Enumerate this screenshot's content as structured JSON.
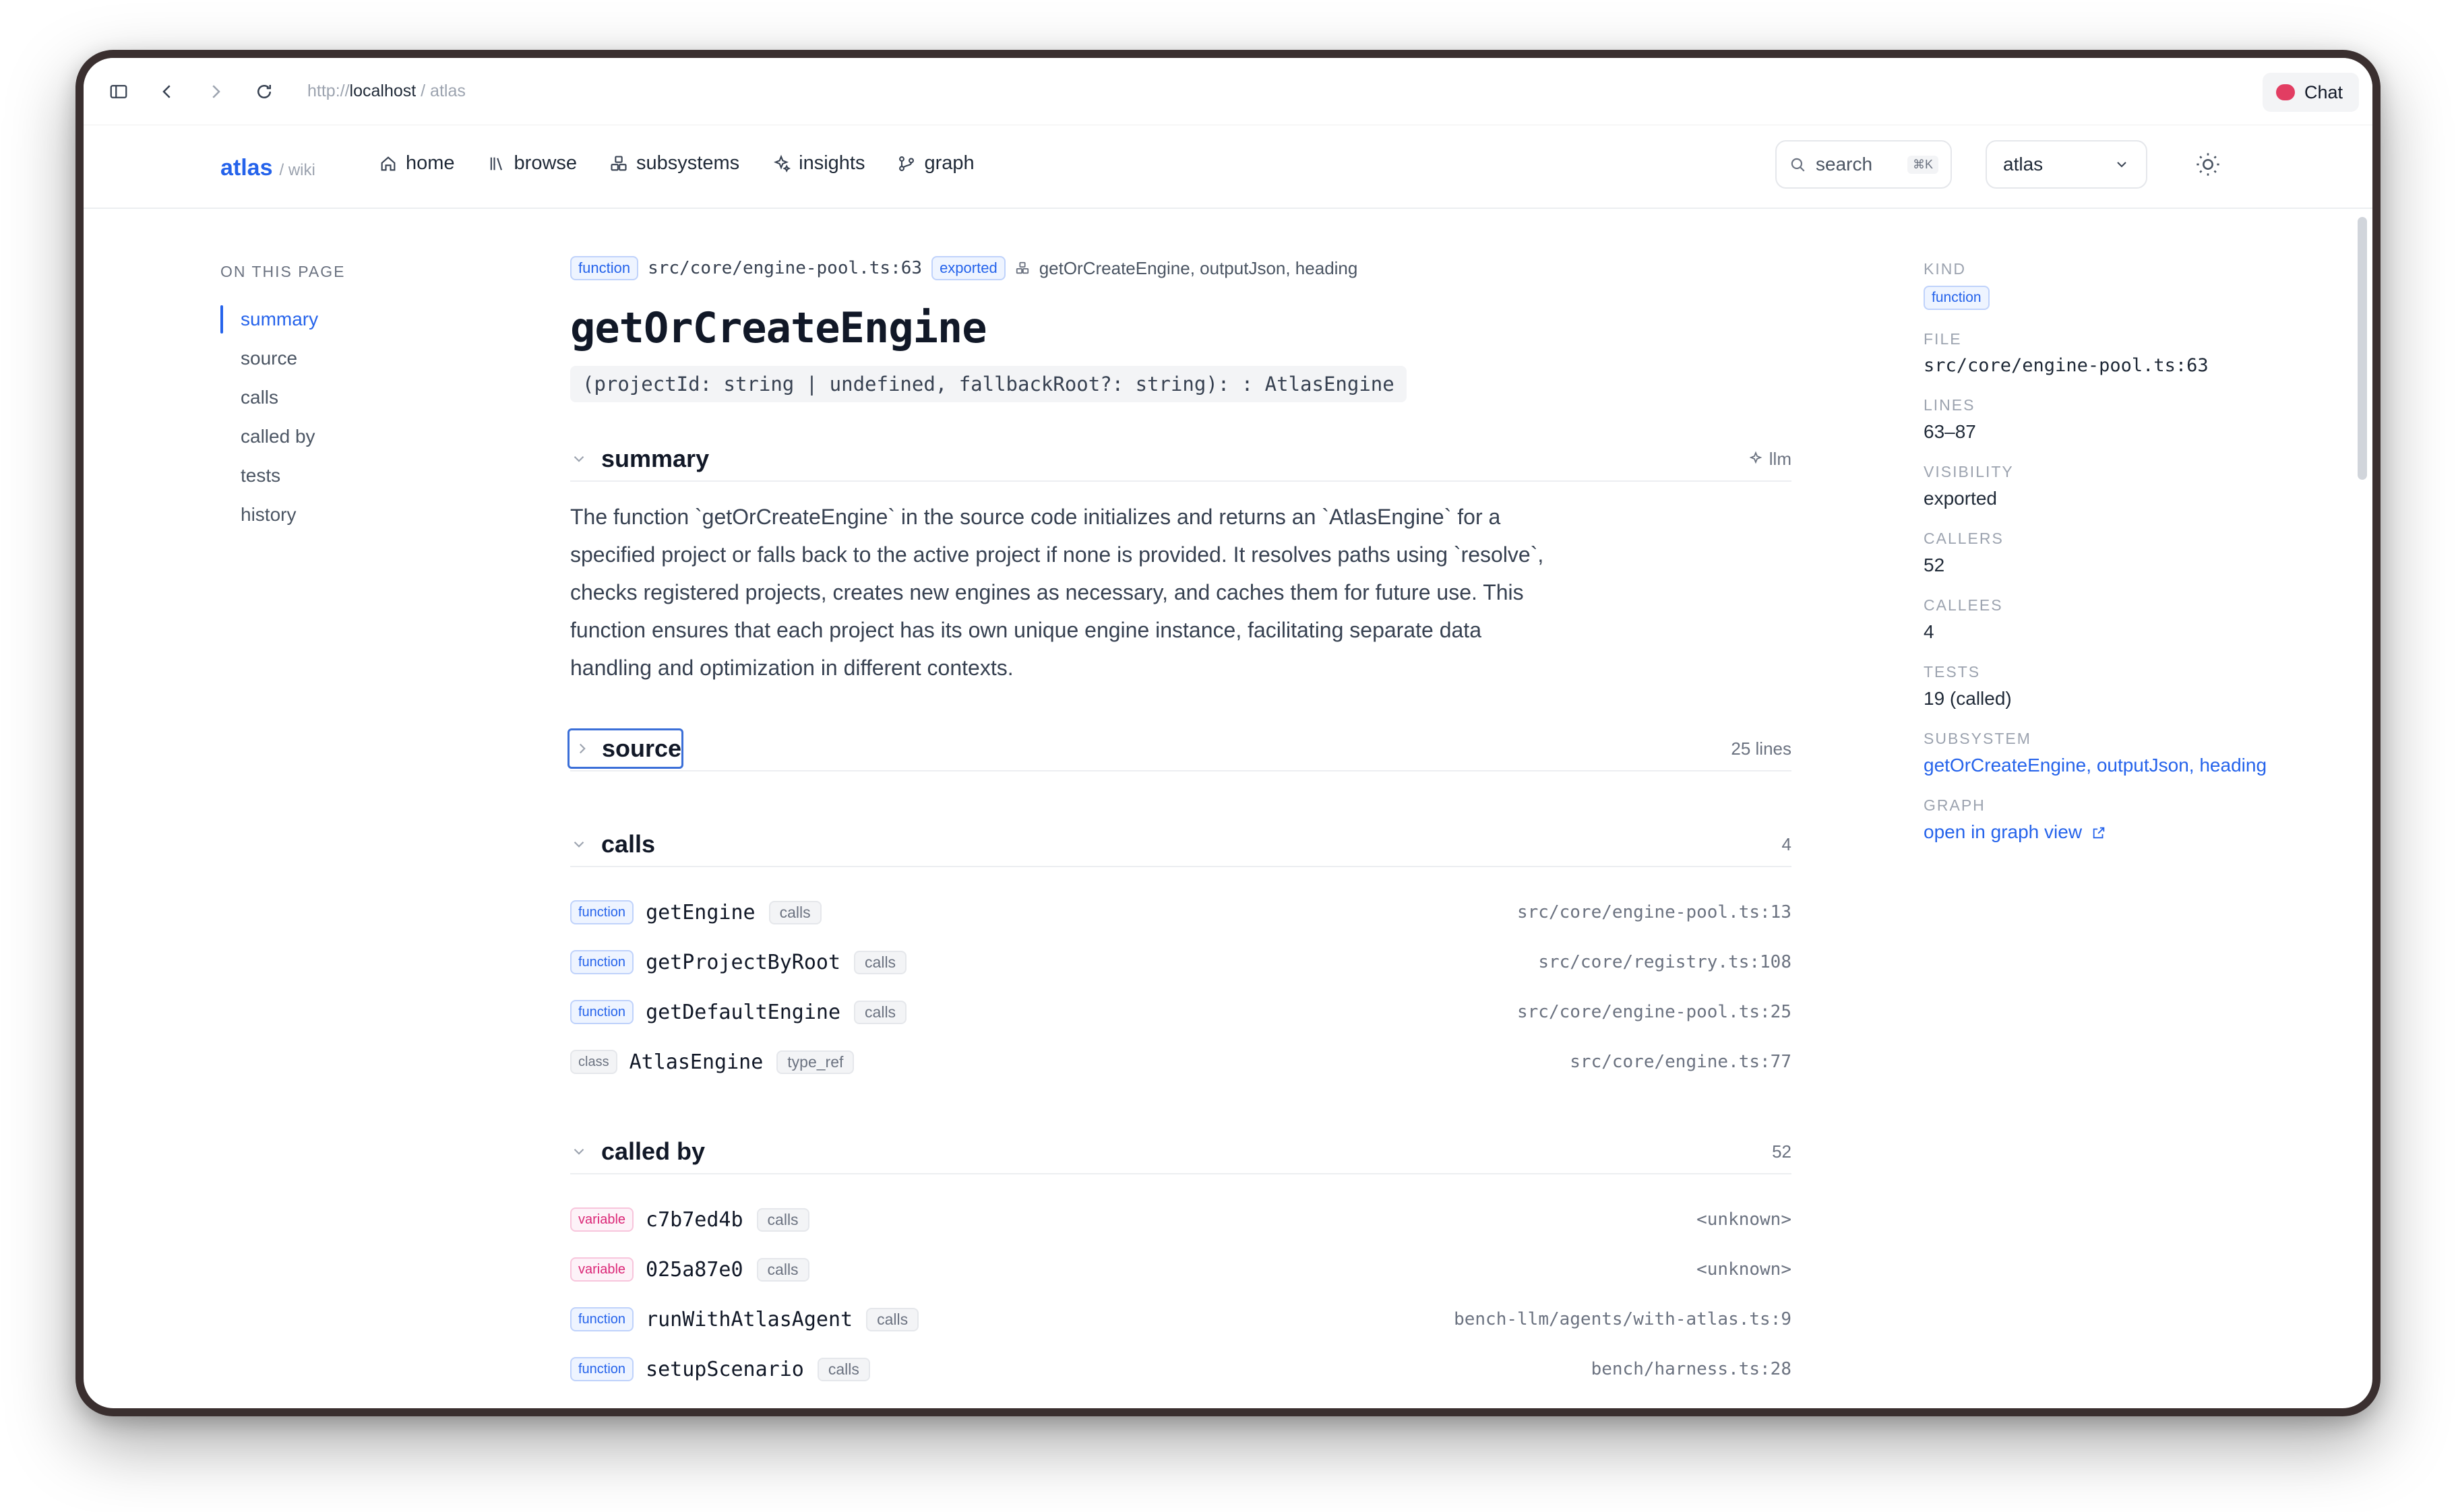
{
  "browser": {
    "url_prefix": "http://",
    "url_host": "localhost",
    "url_path": " / atlas",
    "chat_label": "Chat"
  },
  "header": {
    "brand": "atlas",
    "brand_sub": "/ wiki",
    "nav": [
      "home",
      "browse",
      "subsystems",
      "insights",
      "graph"
    ],
    "search_placeholder": "search",
    "search_shortcut": "⌘K",
    "project_select": "atlas"
  },
  "toc": {
    "heading": "ON THIS PAGE",
    "items": [
      "summary",
      "source",
      "calls",
      "called by",
      "tests",
      "history"
    ]
  },
  "symbol": {
    "kind_badge": "function",
    "file": "src/core/engine-pool.ts:63",
    "visibility_badge": "exported",
    "subsystems": "getOrCreateEngine, outputJson, heading",
    "name": "getOrCreateEngine",
    "signature": "(projectId: string | undefined, fallbackRoot?: string): : AtlasEngine"
  },
  "summary": {
    "title": "summary",
    "source_tag": "llm",
    "text": "The function `getOrCreateEngine` in the source code initializes and returns an `AtlasEngine` for a specified project or falls back to the active project if none is provided. It resolves paths using `resolve`, checks registered projects, creates new engines as necessary, and caches them for future use. This function ensures that each project has its own unique engine instance, facilitating separate data handling and optimization in different contexts."
  },
  "source": {
    "title": "source",
    "count": "25 lines"
  },
  "calls": {
    "title": "calls",
    "count": "4",
    "rows": [
      {
        "kind": "function",
        "name": "getEngine",
        "rel": "calls",
        "loc": "src/core/engine-pool.ts:13"
      },
      {
        "kind": "function",
        "name": "getProjectByRoot",
        "rel": "calls",
        "loc": "src/core/registry.ts:108"
      },
      {
        "kind": "function",
        "name": "getDefaultEngine",
        "rel": "calls",
        "loc": "src/core/engine-pool.ts:25"
      },
      {
        "kind": "class",
        "name": "AtlasEngine",
        "rel": "type_ref",
        "loc": "src/core/engine.ts:77"
      }
    ]
  },
  "called_by": {
    "title": "called by",
    "count": "52",
    "rows": [
      {
        "kind": "variable",
        "name": "c7b7ed4b",
        "rel": "calls",
        "loc": "<unknown>"
      },
      {
        "kind": "variable",
        "name": "025a87e0",
        "rel": "calls",
        "loc": "<unknown>"
      },
      {
        "kind": "function",
        "name": "runWithAtlasAgent",
        "rel": "calls",
        "loc": "bench-llm/agents/with-atlas.ts:9"
      },
      {
        "kind": "function",
        "name": "setupScenario",
        "rel": "calls",
        "loc": "bench/harness.ts:28"
      }
    ]
  },
  "sidebar": {
    "kind_label": "KIND",
    "kind_value": "function",
    "file_label": "FILE",
    "file_value": "src/core/engine-pool.ts:63",
    "lines_label": "LINES",
    "lines_value": "63–87",
    "visibility_label": "VISIBILITY",
    "visibility_value": "exported",
    "callers_label": "CALLERS",
    "callers_value": "52",
    "callees_label": "CALLEES",
    "callees_value": "4",
    "tests_label": "TESTS",
    "tests_value": "19 (called)",
    "subsystem_label": "SUBSYSTEM",
    "subsystem_value": "getOrCreateEngine, outputJson, heading",
    "graph_label": "GRAPH",
    "graph_value": "open in graph view"
  },
  "colors": {
    "accent": "#2563eb",
    "variable": "#db2777",
    "chat": "#e23d62"
  }
}
